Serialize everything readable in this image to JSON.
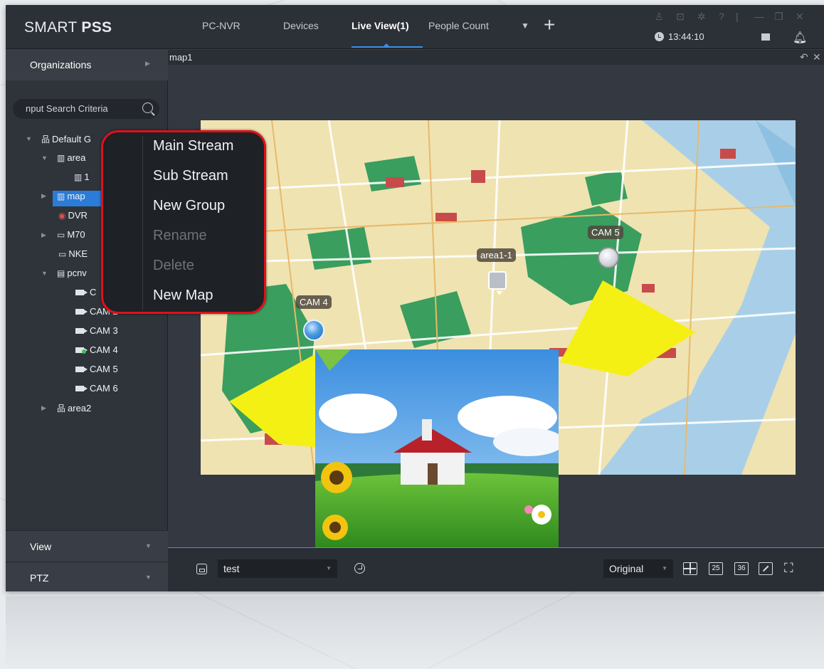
{
  "app": {
    "logo_light": "SMART ",
    "logo_bold": "PSS",
    "time": "13:44:10"
  },
  "tabs": [
    {
      "label": "PC-NVR"
    },
    {
      "label": "Devices"
    },
    {
      "label": "Live View(1)"
    },
    {
      "label": "People Count"
    }
  ],
  "sidebar": {
    "organizations": "Organizations",
    "search_placeholder": "nput Search Criteria",
    "tree": [
      {
        "label": "Default G"
      },
      {
        "label": "area"
      },
      {
        "label": "1"
      },
      {
        "label": "map"
      },
      {
        "label": "DVR"
      },
      {
        "label": "M70"
      },
      {
        "label": "NKE"
      },
      {
        "label": "pcnv"
      },
      {
        "label": "C"
      },
      {
        "label": "CAM 2"
      },
      {
        "label": "CAM 3"
      },
      {
        "label": "CAM 4"
      },
      {
        "label": "CAM 5"
      },
      {
        "label": "CAM 6"
      },
      {
        "label": "area2"
      }
    ],
    "view": "View",
    "ptz": "PTZ"
  },
  "main": {
    "map_title": "map1",
    "labels": {
      "cam5": "CAM 5",
      "area1_1": "area1-1",
      "cam4": "CAM 4"
    }
  },
  "context_menu": {
    "items": [
      {
        "label": "Main Stream",
        "enabled": true
      },
      {
        "label": "Sub Stream",
        "enabled": true
      },
      {
        "label": "New Group",
        "enabled": true
      },
      {
        "label": "Rename",
        "enabled": false
      },
      {
        "label": "Delete",
        "enabled": false
      },
      {
        "label": "New Map",
        "enabled": true
      }
    ]
  },
  "controls": {
    "view_select": "test",
    "scale_select": "Original",
    "layout_25": "25",
    "layout_36": "36"
  },
  "colors": {
    "accent": "#3a8ee6",
    "highlight_ring": "#e0101a",
    "online": "#35c746"
  }
}
